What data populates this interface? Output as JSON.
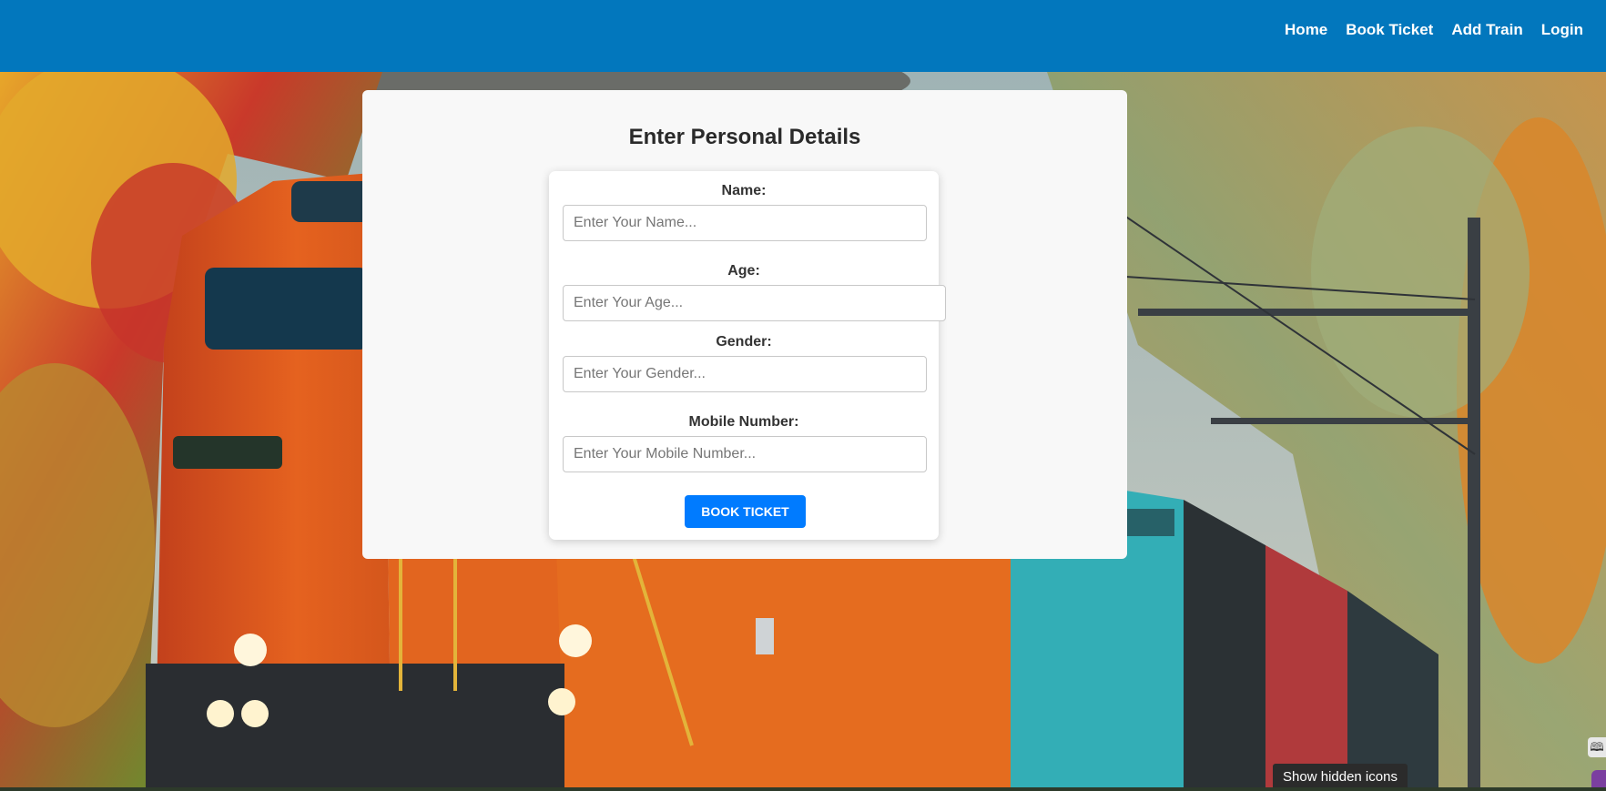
{
  "nav": {
    "links": [
      "Home",
      "Book Ticket",
      "Add Train",
      "Login"
    ]
  },
  "panel": {
    "title": "Enter Personal Details"
  },
  "form": {
    "name_label": "Name:",
    "name_placeholder": "Enter Your Name...",
    "age_label": "Age:",
    "age_placeholder": "Enter Your Age...",
    "gender_label": "Gender:",
    "gender_placeholder": "Enter Your Gender...",
    "mobile_label": "Mobile Number:",
    "mobile_placeholder": "Enter Your Mobile Number...",
    "submit_label": "BOOK TICKET"
  },
  "system": {
    "tooltip": "Show hidden icons"
  },
  "colors": {
    "navbar": "#0277bd",
    "button": "#007bff"
  }
}
